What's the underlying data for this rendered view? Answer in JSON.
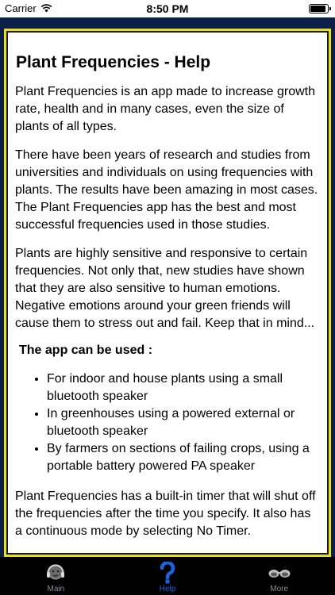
{
  "status_bar": {
    "carrier": "Carrier",
    "time": "8:50 PM"
  },
  "help": {
    "title": "Plant Frequencies - Help",
    "paragraphs": [
      "Plant Frequencies is an app made to increase growth rate, health and in many cases, even the size of plants of all types.",
      "There have been years of research and studies from universities and individuals on using frequencies with plants. The results have been amazing in most cases. The Plant Frequencies app has the best and most successful frequencies used in those studies.",
      "Plants are highly sensitive and responsive to certain frequencies. Not only that, new studies have shown that they are also sensitive to human emotions. Negative emotions around your green friends will cause them to stress out and fail. Keep that in mind..."
    ],
    "uses_heading": "The app can be used :",
    "uses": [
      "For indoor and house plants using a small bluetooth speaker",
      "In greenhouses using a powered external or bluetooth speaker",
      "By farmers on sections of failing crops, using a portable battery powered PA speaker"
    ],
    "timer_paragraph": "Plant Frequencies has a built-in timer that will shut off the frequencies after the time you specify. It also has a continuous mode by selecting No Timer."
  },
  "tabs": [
    {
      "label": "Main",
      "icon": "headphones-icon"
    },
    {
      "label": "Help",
      "icon": "question-mark-icon"
    },
    {
      "label": "More",
      "icon": "more-icon"
    }
  ],
  "colors": {
    "background": "#0b2046",
    "frame_border": "#e9dd1c",
    "active_tab": "#1d63e0",
    "inactive_tab": "#8e8e93"
  }
}
